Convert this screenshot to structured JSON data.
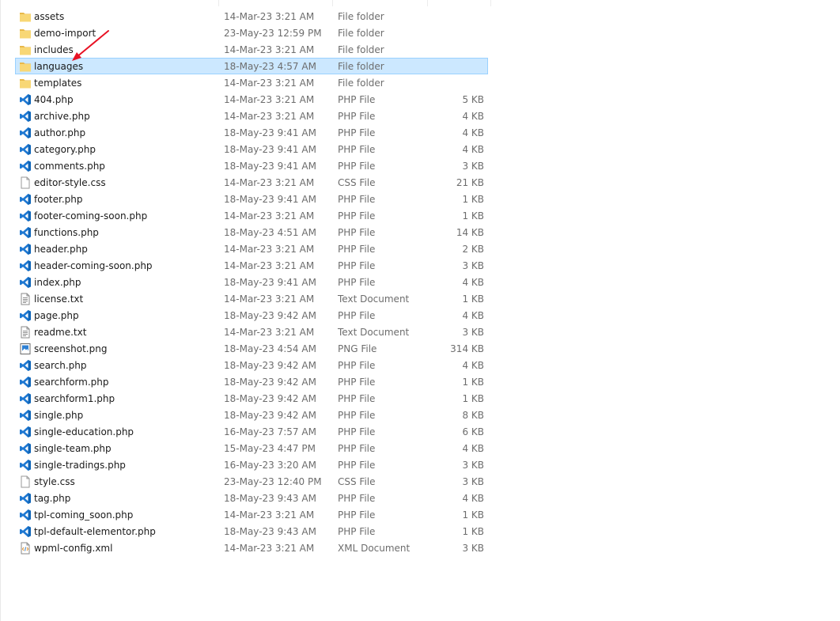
{
  "files": [
    {
      "name": "assets",
      "date": "14-Mar-23 3:21 AM",
      "type": "File folder",
      "size": "",
      "icon": "folder-icon"
    },
    {
      "name": "demo-import",
      "date": "23-May-23 12:59 PM",
      "type": "File folder",
      "size": "",
      "icon": "folder-icon"
    },
    {
      "name": "includes",
      "date": "14-Mar-23 3:21 AM",
      "type": "File folder",
      "size": "",
      "icon": "folder-icon"
    },
    {
      "name": "languages",
      "date": "18-May-23 4:57 AM",
      "type": "File folder",
      "size": "",
      "icon": "folder-icon",
      "selected": true
    },
    {
      "name": "templates",
      "date": "14-Mar-23 3:21 AM",
      "type": "File folder",
      "size": "",
      "icon": "folder-icon"
    },
    {
      "name": "404.php",
      "date": "14-Mar-23 3:21 AM",
      "type": "PHP File",
      "size": "5 KB",
      "icon": "vscode-icon"
    },
    {
      "name": "archive.php",
      "date": "14-Mar-23 3:21 AM",
      "type": "PHP File",
      "size": "4 KB",
      "icon": "vscode-icon"
    },
    {
      "name": "author.php",
      "date": "18-May-23 9:41 AM",
      "type": "PHP File",
      "size": "4 KB",
      "icon": "vscode-icon"
    },
    {
      "name": "category.php",
      "date": "18-May-23 9:41 AM",
      "type": "PHP File",
      "size": "4 KB",
      "icon": "vscode-icon"
    },
    {
      "name": "comments.php",
      "date": "18-May-23 9:41 AM",
      "type": "PHP File",
      "size": "3 KB",
      "icon": "vscode-icon"
    },
    {
      "name": "editor-style.css",
      "date": "14-Mar-23 3:21 AM",
      "type": "CSS File",
      "size": "21 KB",
      "icon": "document-icon"
    },
    {
      "name": "footer.php",
      "date": "18-May-23 9:41 AM",
      "type": "PHP File",
      "size": "1 KB",
      "icon": "vscode-icon"
    },
    {
      "name": "footer-coming-soon.php",
      "date": "14-Mar-23 3:21 AM",
      "type": "PHP File",
      "size": "1 KB",
      "icon": "vscode-icon"
    },
    {
      "name": "functions.php",
      "date": "18-May-23 4:51 AM",
      "type": "PHP File",
      "size": "14 KB",
      "icon": "vscode-icon"
    },
    {
      "name": "header.php",
      "date": "14-Mar-23 3:21 AM",
      "type": "PHP File",
      "size": "2 KB",
      "icon": "vscode-icon"
    },
    {
      "name": "header-coming-soon.php",
      "date": "14-Mar-23 3:21 AM",
      "type": "PHP File",
      "size": "3 KB",
      "icon": "vscode-icon"
    },
    {
      "name": "index.php",
      "date": "18-May-23 9:41 AM",
      "type": "PHP File",
      "size": "4 KB",
      "icon": "vscode-icon"
    },
    {
      "name": "license.txt",
      "date": "14-Mar-23 3:21 AM",
      "type": "Text Document",
      "size": "1 KB",
      "icon": "text-document-icon"
    },
    {
      "name": "page.php",
      "date": "18-May-23 9:42 AM",
      "type": "PHP File",
      "size": "4 KB",
      "icon": "vscode-icon"
    },
    {
      "name": "readme.txt",
      "date": "14-Mar-23 3:21 AM",
      "type": "Text Document",
      "size": "3 KB",
      "icon": "text-document-icon"
    },
    {
      "name": "screenshot.png",
      "date": "18-May-23 4:54 AM",
      "type": "PNG File",
      "size": "314 KB",
      "icon": "image-icon"
    },
    {
      "name": "search.php",
      "date": "18-May-23 9:42 AM",
      "type": "PHP File",
      "size": "4 KB",
      "icon": "vscode-icon"
    },
    {
      "name": "searchform.php",
      "date": "18-May-23 9:42 AM",
      "type": "PHP File",
      "size": "1 KB",
      "icon": "vscode-icon"
    },
    {
      "name": "searchform1.php",
      "date": "18-May-23 9:42 AM",
      "type": "PHP File",
      "size": "1 KB",
      "icon": "vscode-icon"
    },
    {
      "name": "single.php",
      "date": "18-May-23 9:42 AM",
      "type": "PHP File",
      "size": "8 KB",
      "icon": "vscode-icon"
    },
    {
      "name": "single-education.php",
      "date": "16-May-23 7:57 AM",
      "type": "PHP File",
      "size": "6 KB",
      "icon": "vscode-icon"
    },
    {
      "name": "single-team.php",
      "date": "15-May-23 4:47 PM",
      "type": "PHP File",
      "size": "4 KB",
      "icon": "vscode-icon"
    },
    {
      "name": "single-tradings.php",
      "date": "16-May-23 3:20 AM",
      "type": "PHP File",
      "size": "3 KB",
      "icon": "vscode-icon"
    },
    {
      "name": "style.css",
      "date": "23-May-23 12:40 PM",
      "type": "CSS File",
      "size": "3 KB",
      "icon": "document-icon"
    },
    {
      "name": "tag.php",
      "date": "18-May-23 9:43 AM",
      "type": "PHP File",
      "size": "4 KB",
      "icon": "vscode-icon"
    },
    {
      "name": "tpl-coming_soon.php",
      "date": "14-Mar-23 3:21 AM",
      "type": "PHP File",
      "size": "1 KB",
      "icon": "vscode-icon"
    },
    {
      "name": "tpl-default-elementor.php",
      "date": "18-May-23 9:43 AM",
      "type": "PHP File",
      "size": "1 KB",
      "icon": "vscode-icon"
    },
    {
      "name": "wpml-config.xml",
      "date": "14-Mar-23 3:21 AM",
      "type": "XML Document",
      "size": "3 KB",
      "icon": "xml-document-icon"
    }
  ],
  "colors": {
    "selection_bg": "#cce8ff",
    "selection_border": "#99d1ff",
    "folder": "#f8d775",
    "vscode": "#1e78d2",
    "annotation_arrow": "#e81123"
  }
}
